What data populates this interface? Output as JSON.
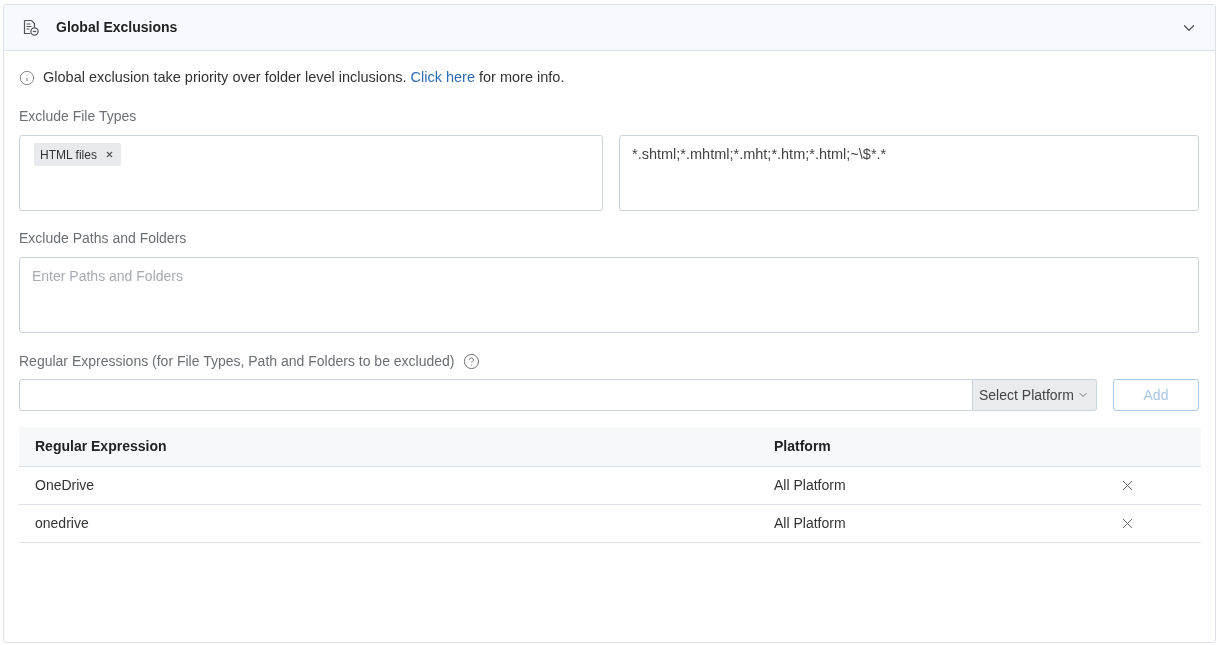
{
  "panel": {
    "title": "Global Exclusions",
    "expanded": true
  },
  "info": {
    "text_before": "Global exclusion take priority over folder level inclusions.",
    "link": "Click here",
    "text_after": "for more info."
  },
  "exclude_file_types": {
    "label": "Exclude File Types",
    "tags": [
      {
        "label": "HTML files"
      }
    ],
    "patterns": "*.shtml;*.mhtml;*.mht;*.htm;*.html;~\\$*.*"
  },
  "exclude_paths": {
    "label": "Exclude Paths and Folders",
    "placeholder": "Enter Paths and Folders"
  },
  "regular_expressions": {
    "label": "Regular Expressions (for File Types, Path and Folders to be excluded)",
    "platform_select": "Select Platform",
    "add_button": {
      "label": "Add",
      "disabled": true
    }
  },
  "table": {
    "columns": [
      "Regular Expression",
      "Platform"
    ],
    "rows": [
      {
        "expression": "OneDrive",
        "platform": "All Platform"
      },
      {
        "expression": "onedrive",
        "platform": "All Platform"
      }
    ]
  }
}
